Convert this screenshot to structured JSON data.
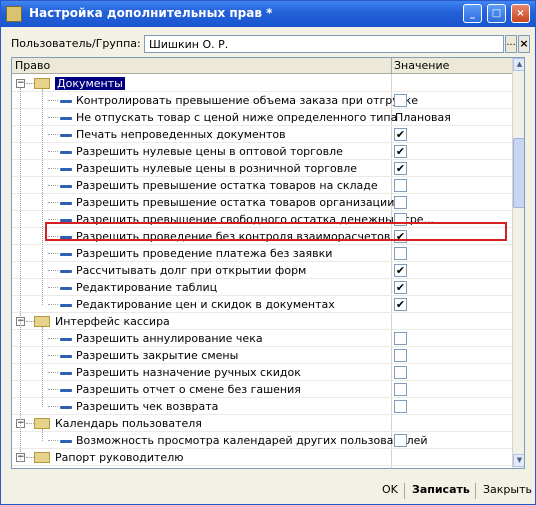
{
  "window": {
    "title": "Настройка дополнительных прав *"
  },
  "user": {
    "label": "Пользователь/Группа:",
    "value": "Шишкин О. Р.",
    "select_btn": "...",
    "clear_btn": "×"
  },
  "grid": {
    "col_right": "Право",
    "col_value": "Значение",
    "rows": [
      {
        "kind": "group",
        "label": "Документы",
        "expander": "−"
      },
      {
        "kind": "item",
        "label": "Контролировать превышение объема заказа при отгрузке",
        "checked": false
      },
      {
        "kind": "item",
        "label": "Не отпускать товар с ценой ниже определенного типа",
        "value": "Плановая"
      },
      {
        "kind": "item",
        "label": "Печать непроведенных документов",
        "checked": true
      },
      {
        "kind": "item",
        "label": "Разрешить нулевые цены в оптовой торговле",
        "checked": true
      },
      {
        "kind": "item",
        "label": "Разрешить нулевые цены в розничной торговле",
        "checked": true
      },
      {
        "kind": "item",
        "label": "Разрешить превышение остатка товаров на складе",
        "checked": false
      },
      {
        "kind": "item",
        "label": "Разрешить превышение остатка товаров организации",
        "checked": false
      },
      {
        "kind": "item",
        "label": "Разрешить превышение свободного остатка денежных сре...",
        "checked": false
      },
      {
        "kind": "item",
        "label": "Разрешить проведение без контроля взаиморасчетов",
        "checked": true
      },
      {
        "kind": "item",
        "label": "Разрешить проведение платежа без заявки",
        "checked": false
      },
      {
        "kind": "item",
        "label": "Рассчитывать долг при открытии форм",
        "checked": true
      },
      {
        "kind": "item",
        "label": "Редактирование таблиц",
        "checked": true
      },
      {
        "kind": "item",
        "label": "Редактирование цен и скидок в документах",
        "checked": true
      },
      {
        "kind": "group",
        "label": "Интерфейс кассира",
        "expander": "−"
      },
      {
        "kind": "item",
        "label": "Разрешить аннулирование чека",
        "checked": false
      },
      {
        "kind": "item",
        "label": "Разрешить закрытие смены",
        "checked": false
      },
      {
        "kind": "item",
        "label": "Разрешить назначение ручных скидок",
        "checked": false
      },
      {
        "kind": "item",
        "label": "Разрешить отчет о смене без гашения",
        "checked": false
      },
      {
        "kind": "item",
        "label": "Разрешить чек возврата",
        "checked": false
      },
      {
        "kind": "group",
        "label": "Календарь пользователя",
        "expander": "−"
      },
      {
        "kind": "item",
        "label": "Возможность просмотра календарей других пользователей",
        "checked": false
      },
      {
        "kind": "group",
        "label": "Рапорт руководителю",
        "expander": "−"
      }
    ]
  },
  "footer": {
    "ok": "OK",
    "save": "Записать",
    "close": "Закрыть"
  },
  "colors": {
    "highlight": "#d42020",
    "selection": "#000080",
    "titlebar": "#2462d9"
  },
  "checkmark": "✔"
}
